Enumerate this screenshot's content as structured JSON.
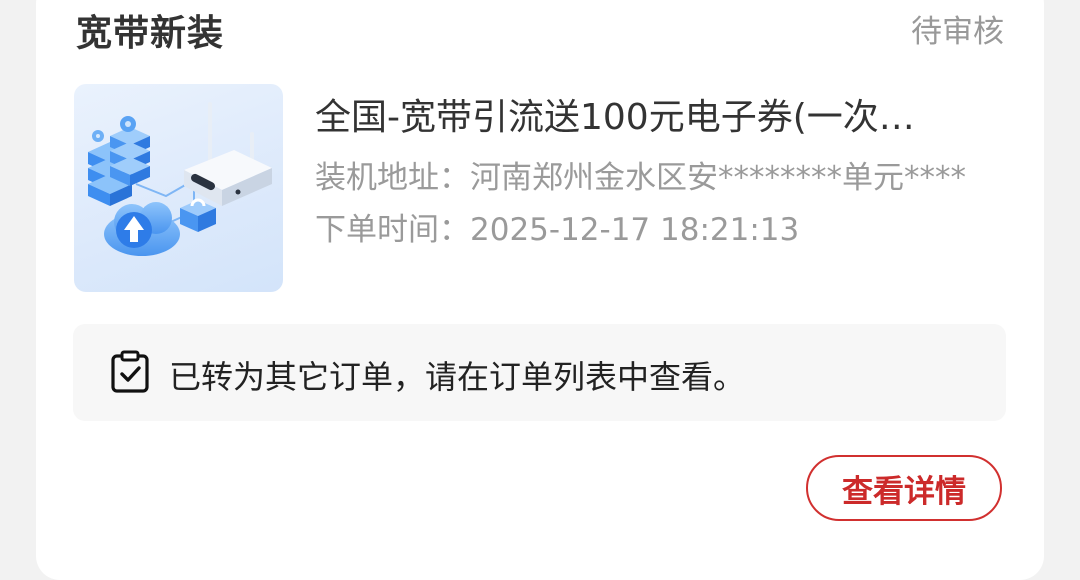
{
  "order": {
    "title": "宽带新装",
    "status": "待审核",
    "product_name": "全国-宽带引流送100元电子券(一次…",
    "address_label": "装机地址：",
    "address_value": "河南郑州金水区安********单元****",
    "time_label": "下单时间：",
    "time_value": "2025-12-17 18:21:13",
    "thumbnail_icon": "broadband-router-illustration"
  },
  "notice": {
    "icon": "clipboard-check-icon",
    "text": "已转为其它订单，请在订单列表中查看。"
  },
  "actions": {
    "detail_label": "查看详情"
  },
  "colors": {
    "accent": "#cc2a2a",
    "muted_text": "#9a9a9a",
    "primary_text": "#333333"
  }
}
